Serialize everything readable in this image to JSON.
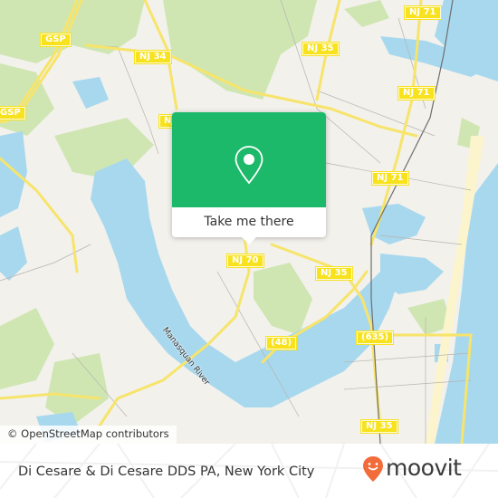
{
  "map": {
    "road_shields": [
      {
        "label": "GSP"
      },
      {
        "label": "GSP"
      },
      {
        "label": "NJ 34"
      },
      {
        "label": "NJ 35"
      },
      {
        "label": "NJ 71"
      },
      {
        "label": "NJ 71"
      },
      {
        "label": "NJ 71"
      },
      {
        "label": "NJ 70"
      },
      {
        "label": "NJ 35"
      },
      {
        "label": "(48)"
      },
      {
        "label": "(635)"
      },
      {
        "label": "NJ 35"
      },
      {
        "label": "NJ"
      }
    ],
    "water_labels": [
      {
        "label": "Manasquan River"
      }
    ],
    "colors": {
      "land": "#f2f1ec",
      "water": "#a8d8ee",
      "park": "#cfe6b3",
      "road_major": "#f7e46a",
      "shield": "#f7e21d",
      "beach": "#fbf4cc"
    },
    "attribution": "© OpenStreetMap contributors"
  },
  "popup": {
    "icon": "map-pin-icon",
    "button_label": "Take me there",
    "accent_color": "#1cb96a"
  },
  "footer": {
    "place_name": "Di Cesare & Di Cesare DDS PA, New York City",
    "brand": {
      "name": "moovit",
      "icon": "moovit-face-pin-icon",
      "color": "#f26b3a"
    }
  }
}
